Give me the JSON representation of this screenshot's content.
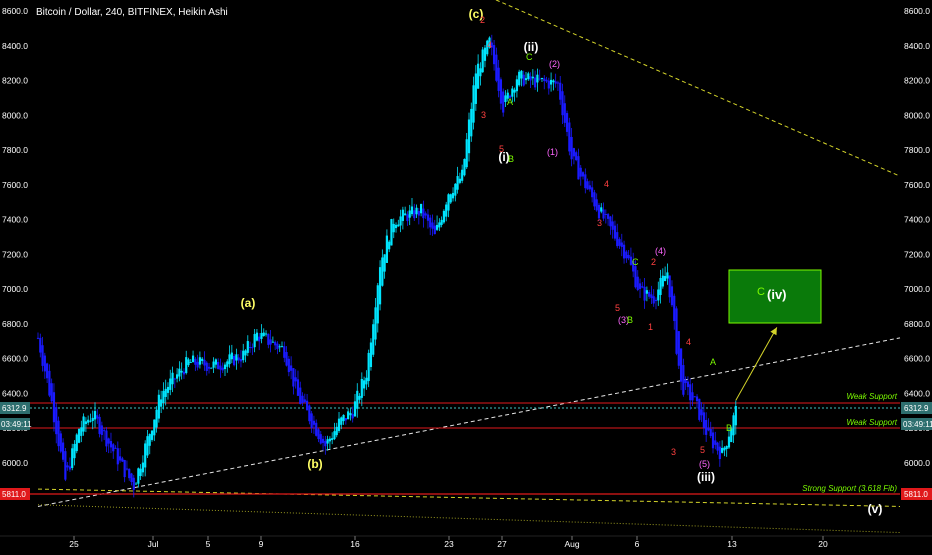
{
  "header": {
    "symbol_title": "Bitcoin / Dollar, 240, BITFINEX, Heikin Ashi"
  },
  "colors": {
    "background": "#000000",
    "bull": "#00e5ff",
    "bear": "#1a1aff",
    "trendline_yellow": "#d4d42a",
    "trendline_white": "#e6e6e6",
    "support_red": "#e0191b",
    "support_text": "#7cfc00",
    "price_line": "#3fbfbf",
    "box_fill": "#0a7a0a",
    "box_border": "#7cfc00",
    "wave_yellow": "#ffff66",
    "wave_white": "#ffffff",
    "wave_red": "#ff4040",
    "wave_green": "#7cfc00",
    "wave_magenta": "#ff66ff"
  },
  "axes": {
    "y_ticks": [
      "8600.0",
      "8400.0",
      "8200.0",
      "8000.0",
      "7800.0",
      "7600.0",
      "7400.0",
      "7200.0",
      "7000.0",
      "6800.0",
      "6600.0",
      "6400.0",
      "6200.0",
      "6000.0"
    ],
    "x_ticks": [
      "25",
      "Jul",
      "5",
      "9",
      "16",
      "23",
      "27",
      "Aug",
      "6",
      "13",
      "20"
    ],
    "price_badges": [
      "6312.9",
      "03:49:11",
      "5811.0"
    ]
  },
  "support_labels": [
    "Weak Support",
    "Weak Support",
    "Strong Support (3.618 Fib)"
  ],
  "target_box": {
    "label_c": "C",
    "label_iv": "(iv)"
  },
  "wave_labels": {
    "a": "(a)",
    "b": "(b)",
    "c": "(c)",
    "i": "(i)",
    "ii": "(ii)",
    "iii": "(iii)",
    "v": "(v)",
    "minor": [
      "2",
      "4",
      "3",
      "5",
      "A",
      "B",
      "C",
      "(2)",
      "(1)",
      "4",
      "3",
      "C",
      "2",
      "(4)",
      "5",
      "(3)",
      "B",
      "1",
      "4",
      "A",
      "3",
      "5",
      "(5)",
      "B"
    ]
  },
  "chart_data": {
    "type": "candlestick",
    "title": "Bitcoin / Dollar, 240, BITFINEX, Heikin Ashi",
    "y_range": [
      5700,
      8680
    ],
    "x_range": [
      "2018-06-22",
      "2018-08-24"
    ],
    "current_price": 6312.9,
    "countdown": "03:49:11",
    "support_levels": [
      {
        "price": 6335,
        "label": "Weak Support"
      },
      {
        "price": 6195,
        "label": "Weak Support"
      },
      {
        "price": 5811.0,
        "label": "Strong Support (3.618 Fib)"
      }
    ],
    "projection_target": {
      "label": "C (iv)",
      "price_low": 6800,
      "price_high": 7100
    },
    "price_path": [
      {
        "date": "2018-06-22",
        "price": 6720
      },
      {
        "date": "2018-06-23",
        "price": 6350
      },
      {
        "date": "2018-06-24",
        "price": 5900
      },
      {
        "date": "2018-06-25",
        "price": 6200
      },
      {
        "date": "2018-06-26",
        "price": 6280
      },
      {
        "date": "2018-06-28",
        "price": 6000
      },
      {
        "date": "2018-06-29",
        "price": 5870
      },
      {
        "date": "2018-07-01",
        "price": 6400
      },
      {
        "date": "2018-07-03",
        "price": 6580
      },
      {
        "date": "2018-07-05",
        "price": 6560
      },
      {
        "date": "2018-07-07",
        "price": 6620
      },
      {
        "date": "2018-07-08",
        "price": 6740
      },
      {
        "date": "2018-07-10",
        "price": 6650
      },
      {
        "date": "2018-07-11",
        "price": 6380
      },
      {
        "date": "2018-07-13",
        "price": 6100
      },
      {
        "date": "2018-07-14",
        "price": 6230
      },
      {
        "date": "2018-07-15",
        "price": 6300
      },
      {
        "date": "2018-07-16",
        "price": 6520
      },
      {
        "date": "2018-07-17",
        "price": 7150
      },
      {
        "date": "2018-07-18",
        "price": 7400
      },
      {
        "date": "2018-07-20",
        "price": 7450
      },
      {
        "date": "2018-07-21",
        "price": 7300
      },
      {
        "date": "2018-07-22",
        "price": 7560
      },
      {
        "date": "2018-07-23",
        "price": 7650
      },
      {
        "date": "2018-07-24",
        "price": 8250
      },
      {
        "date": "2018-07-25",
        "price": 8420
      },
      {
        "date": "2018-07-26",
        "price": 8050
      },
      {
        "date": "2018-07-27",
        "price": 8220
      },
      {
        "date": "2018-07-28",
        "price": 8200
      },
      {
        "date": "2018-07-30",
        "price": 8180
      },
      {
        "date": "2018-07-31",
        "price": 7750
      },
      {
        "date": "2018-08-02",
        "price": 7450
      },
      {
        "date": "2018-08-04",
        "price": 7200
      },
      {
        "date": "2018-08-05",
        "price": 6980
      },
      {
        "date": "2018-08-06",
        "price": 6950
      },
      {
        "date": "2018-08-07",
        "price": 7100
      },
      {
        "date": "2018-08-08",
        "price": 6450
      },
      {
        "date": "2018-08-09",
        "price": 6350
      },
      {
        "date": "2018-08-10",
        "price": 6150
      },
      {
        "date": "2018-08-11",
        "price": 6050
      },
      {
        "date": "2018-08-12",
        "price": 6300
      }
    ],
    "trendlines": [
      {
        "style": "dashed-yellow",
        "from": {
          "date": "2018-06-22",
          "price": 5850
        },
        "to": {
          "date": "2018-08-24",
          "price": 5750
        }
      },
      {
        "style": "dashed-yellow",
        "from": {
          "date": "2018-07-25",
          "price": 8680
        },
        "to": {
          "date": "2018-08-24",
          "price": 7650
        }
      },
      {
        "style": "dashed-white",
        "from": {
          "date": "2018-06-22",
          "price": 5750
        },
        "to": {
          "date": "2018-08-24",
          "price": 6720
        }
      },
      {
        "style": "dotted-yellow",
        "from": {
          "date": "2018-06-22",
          "price": 5760
        },
        "to": {
          "date": "2018-08-24",
          "price": 5600
        }
      },
      {
        "style": "arrow-yellow",
        "from": {
          "date": "2018-08-12",
          "price": 6360
        },
        "to": {
          "date": "2018-08-15",
          "price": 6780
        }
      }
    ],
    "wave_labels": [
      {
        "text": "(a)",
        "date": "2018-07-08",
        "price": 6830
      },
      {
        "text": "(b)",
        "date": "2018-07-12",
        "price": 6000
      },
      {
        "text": "(c)",
        "date": "2018-07-25",
        "price": 8620
      },
      {
        "text": "(i)",
        "date": "2018-07-26",
        "price": 7760
      },
      {
        "text": "(ii)",
        "date": "2018-07-29",
        "price": 8380
      },
      {
        "text": "(iii)",
        "date": "2018-08-10",
        "price": 5900
      },
      {
        "text": "(v)",
        "date": "2018-08-20",
        "price": 5720
      }
    ]
  }
}
